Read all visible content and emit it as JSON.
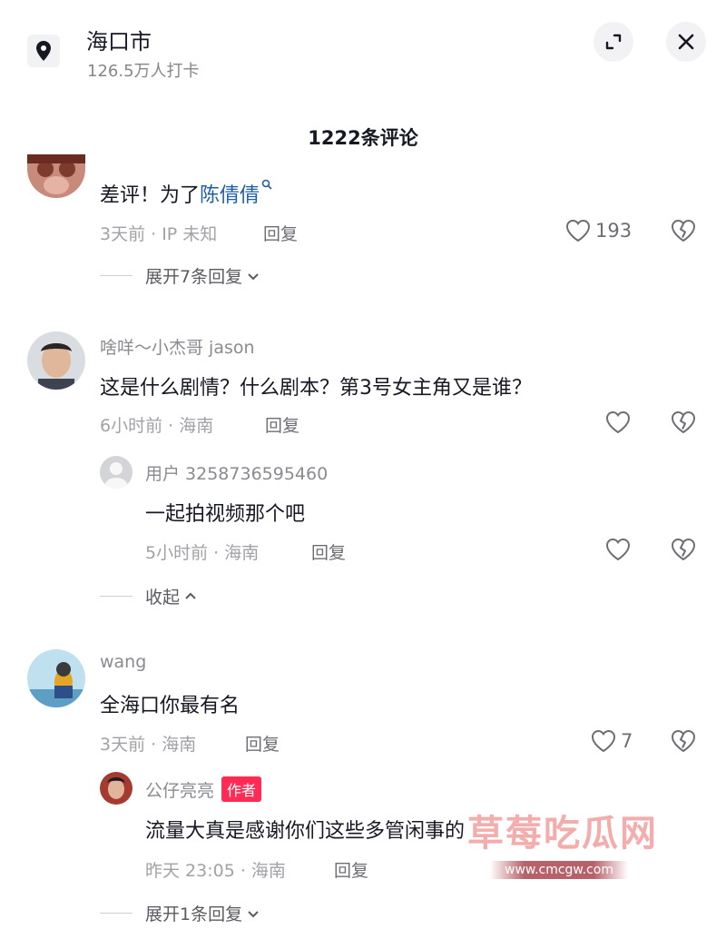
{
  "header": {
    "location_name": "海口市",
    "location_subtitle": "126.5万人打卡",
    "icons": {
      "pin": "location-pin-icon",
      "expand": "expand-icon",
      "close": "close-icon"
    }
  },
  "comment_count": "1222条评论",
  "comments": [
    {
      "text_prefix": "差评！为了",
      "text_link": "陈倩倩",
      "meta": "3天前 · IP 未知",
      "reply_label": "回复",
      "likes": "193",
      "expand_label": "展开7条回复"
    },
    {
      "username": "啥咩～小杰哥 jason",
      "text": "这是什么剧情？什么剧本？第3号女主角又是谁？",
      "meta": "6小时前 · 海南",
      "reply_label": "回复",
      "reply": {
        "username": "用户 3258736595460",
        "text": "一起拍视频那个吧",
        "meta": "5小时前 · 海南",
        "reply_label": "回复"
      },
      "collapse_label": "收起"
    },
    {
      "username": "wang",
      "text": "全海口你最有名",
      "meta": "3天前 · 海南",
      "reply_label": "回复",
      "likes": "7",
      "reply": {
        "username": "公仔亮亮",
        "badge": "作者",
        "text": "流量大真是感谢你们这些多管闲事的",
        "meta": "昨天 23:05 · 海南",
        "reply_label": "回复"
      },
      "expand_label": "展开1条回复"
    }
  ],
  "watermark": {
    "title": "草莓吃瓜网",
    "url": "www.cmcgw.com"
  },
  "colors": {
    "accent_red": "#fe2c55",
    "link_blue": "#1f5fa8",
    "meta_gray": "#a1a2a7"
  }
}
